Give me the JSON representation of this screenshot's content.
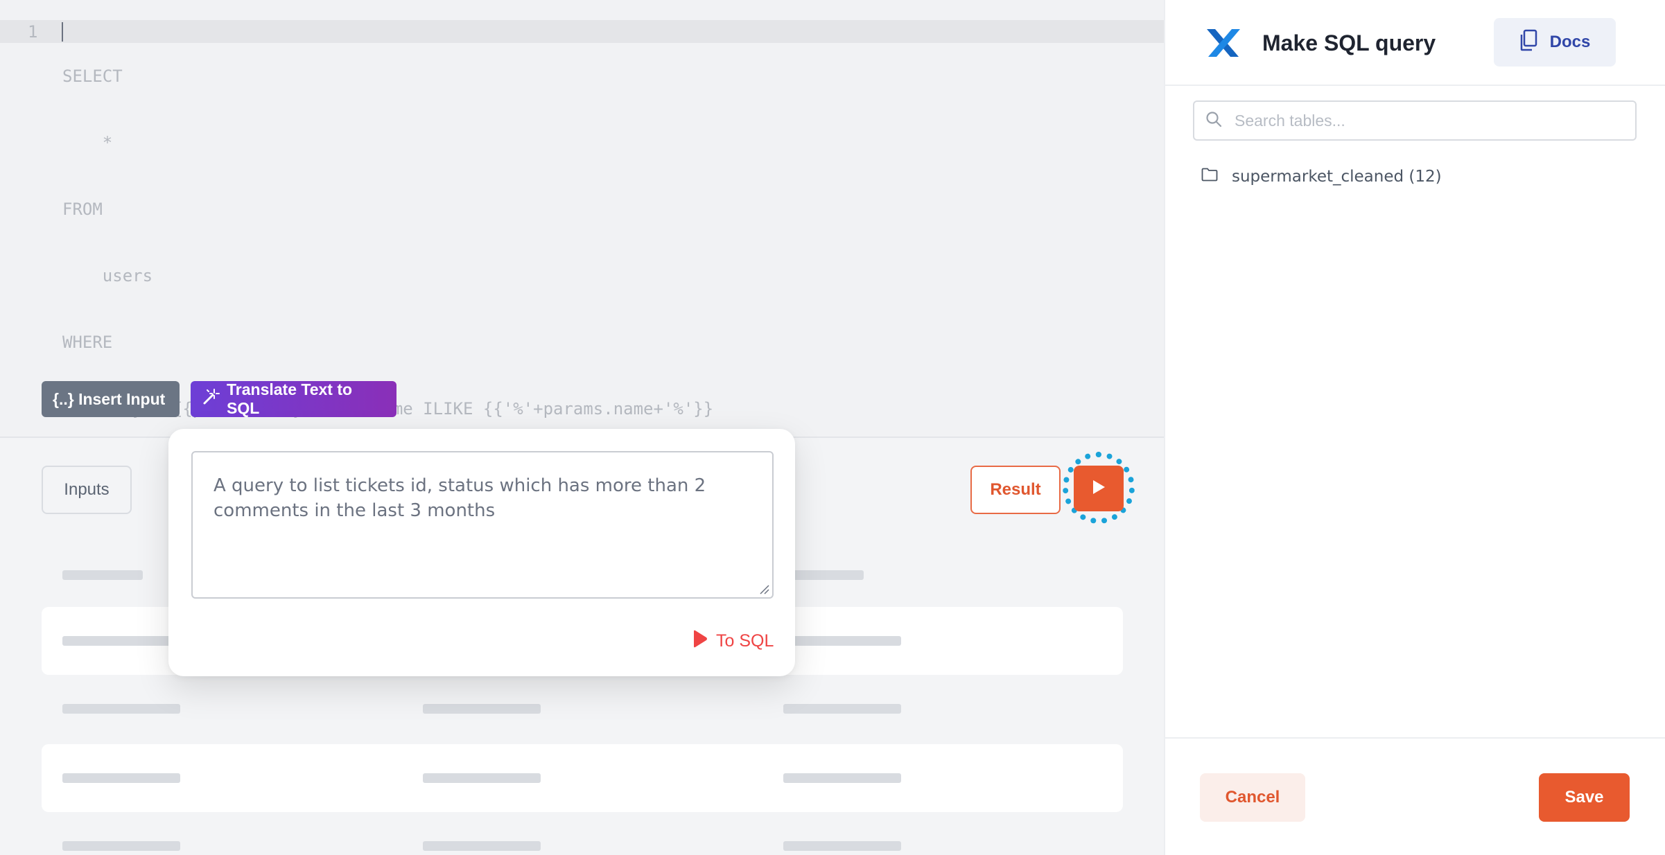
{
  "editor": {
    "line_number": "1",
    "code_lines": [
      "SELECT",
      "    *",
      "FROM",
      "    users",
      "WHERE",
      "    city = {{params.city}} AND name ILIKE {{'%'+params.name+'%'}}"
    ],
    "insert_input_label": "{..} Insert Input",
    "translate_label": "Translate Text to SQL"
  },
  "results": {
    "inputs_tab_label": "Inputs",
    "result_label": "Result"
  },
  "popover": {
    "prompt_text": "A query to list tickets id, status which has more than 2 comments in the last 3 months",
    "to_sql_label": "To SQL"
  },
  "panel": {
    "title": "Make SQL query",
    "docs_label": "Docs",
    "search_placeholder": "Search tables...",
    "tree_item_label": "supermarket_cleaned (12)",
    "cancel_label": "Cancel",
    "save_label": "Save"
  },
  "colors": {
    "accent": "#e85a2f",
    "translate_gradient_start": "#6d3fd6",
    "translate_gradient_end": "#8a2fb8",
    "brand_logo": "#1565c0",
    "docs_text": "#3046a8",
    "run_highlight": "#1aa3d9"
  },
  "icons": [
    "magic-wand-icon",
    "play-icon",
    "x-logo-icon",
    "copy-icon",
    "search-icon",
    "folder-icon"
  ]
}
